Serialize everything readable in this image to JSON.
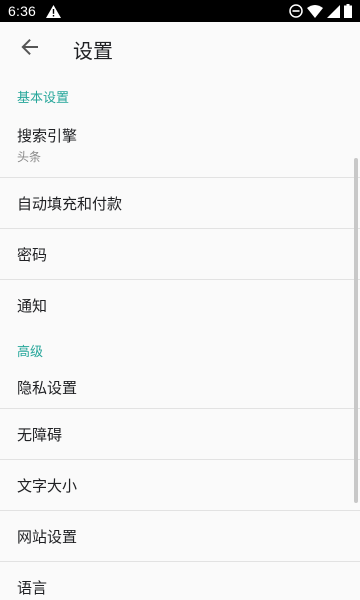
{
  "status_bar": {
    "time": "6:36",
    "icons": [
      "warning-icon",
      "do-not-disturb-icon",
      "wifi-icon",
      "signal-icon",
      "battery-icon"
    ]
  },
  "app_bar": {
    "back_icon": "arrow-back-icon",
    "title": "设置"
  },
  "sections": [
    {
      "header": "基本设置",
      "items": [
        {
          "title": "搜索引擎",
          "summary": "头条"
        },
        {
          "title": "自动填充和付款"
        },
        {
          "title": "密码"
        },
        {
          "title": "通知"
        }
      ]
    },
    {
      "header": "高级",
      "items": [
        {
          "title": "隐私设置"
        },
        {
          "title": "无障碍"
        },
        {
          "title": "文字大小"
        },
        {
          "title": "网站设置"
        },
        {
          "title": "语言"
        }
      ]
    }
  ],
  "colors": {
    "accent": "#26a69a",
    "status_bar": "#000000",
    "background": "#fafafa"
  }
}
